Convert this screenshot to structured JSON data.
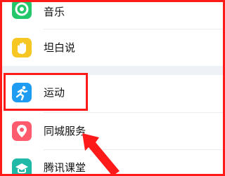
{
  "items": [
    {
      "label": "音乐",
      "icon": "music-icon",
      "color": "#24c76a"
    },
    {
      "label": "坦白说",
      "icon": "hand-icon",
      "color": "#f6c623"
    },
    {
      "label": "运动",
      "icon": "running-icon",
      "color": "#1e9cf2"
    },
    {
      "label": "同城服务",
      "icon": "location-pin-icon",
      "color": "#ff5b6f"
    },
    {
      "label": "腾讯课堂",
      "icon": "graduation-cap-icon",
      "color": "#20b8a6"
    }
  ],
  "colors": {
    "highlight": "#ff1a1a",
    "section_gap": "#eef1f6"
  }
}
